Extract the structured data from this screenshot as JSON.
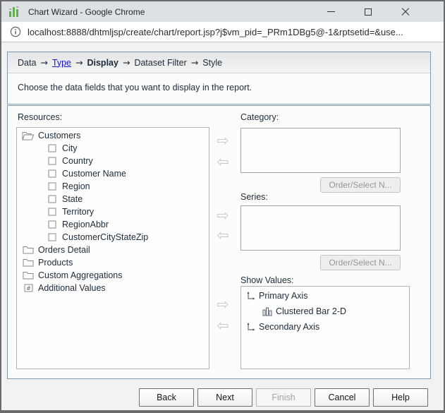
{
  "window": {
    "title": "Chart Wizard - Google Chrome",
    "logo_color": "#61b148"
  },
  "address_bar": {
    "url": "localhost:8888/dhtmljsp/create/chart/report.jsp?j$vm_pid=_PRm1DBg5@-1&rptsetid=&use..."
  },
  "breadcrumb": {
    "separator": "→",
    "steps": [
      {
        "label": "Data",
        "state": "normal"
      },
      {
        "label": "Type",
        "state": "link"
      },
      {
        "label": "Display",
        "state": "current"
      },
      {
        "label": "Dataset Filter",
        "state": "normal"
      },
      {
        "label": "Style",
        "state": "normal"
      }
    ]
  },
  "instruction": "Choose the data fields that you want to display in the report.",
  "resources": {
    "label": "Resources:",
    "tree": [
      {
        "label": "Customers",
        "icon": "folder-open",
        "indent": 0
      },
      {
        "label": "City",
        "icon": "field",
        "indent": 1
      },
      {
        "label": "Country",
        "icon": "field",
        "indent": 1
      },
      {
        "label": "Customer Name",
        "icon": "field",
        "indent": 1
      },
      {
        "label": "Region",
        "icon": "field",
        "indent": 1
      },
      {
        "label": "State",
        "icon": "field",
        "indent": 1
      },
      {
        "label": "Territory",
        "icon": "field",
        "indent": 1
      },
      {
        "label": "RegionAbbr",
        "icon": "field",
        "indent": 1
      },
      {
        "label": "CustomerCityStateZip",
        "icon": "field",
        "indent": 1
      },
      {
        "label": "Orders Detail",
        "icon": "folder",
        "indent": 0
      },
      {
        "label": "Products",
        "icon": "folder",
        "indent": 0
      },
      {
        "label": "Custom Aggregations",
        "icon": "folder",
        "indent": 0
      },
      {
        "label": "Additional Values",
        "icon": "hash-field",
        "indent": 0
      }
    ]
  },
  "category": {
    "label": "Category:",
    "items": [],
    "button_label": "Order/Select N..."
  },
  "series": {
    "label": "Series:",
    "items": [],
    "button_label": "Order/Select N..."
  },
  "show_values": {
    "label": "Show Values:",
    "tree": [
      {
        "label": "Primary Axis",
        "icon": "axis",
        "indent": 0
      },
      {
        "label": "Clustered Bar 2-D",
        "icon": "bar-chart",
        "indent": 1
      },
      {
        "label": "Secondary Axis",
        "icon": "axis",
        "indent": 0
      }
    ]
  },
  "footer": {
    "buttons": [
      {
        "label": "Back",
        "enabled": true
      },
      {
        "label": "Next",
        "enabled": true
      },
      {
        "label": "Finish",
        "enabled": false
      },
      {
        "label": "Cancel",
        "enabled": true
      },
      {
        "label": "Help",
        "enabled": true
      }
    ]
  },
  "colors": {
    "box_border": "#8399b0",
    "link_blue": "#1414cc",
    "logo_green": "#61b148",
    "titlebar_bg": "#dde1e6"
  }
}
